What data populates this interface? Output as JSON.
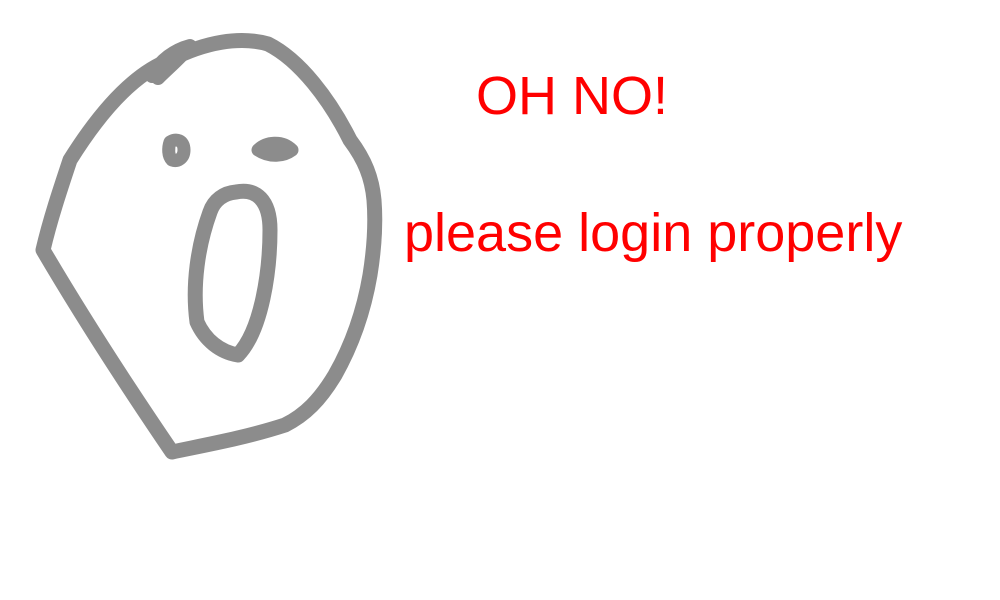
{
  "error": {
    "headline": "OH NO!",
    "message": "please login properly",
    "text_color": "#ff0000"
  },
  "illustration": {
    "icon": "shocked-face-icon",
    "stroke_color": "#8c8c8c"
  }
}
